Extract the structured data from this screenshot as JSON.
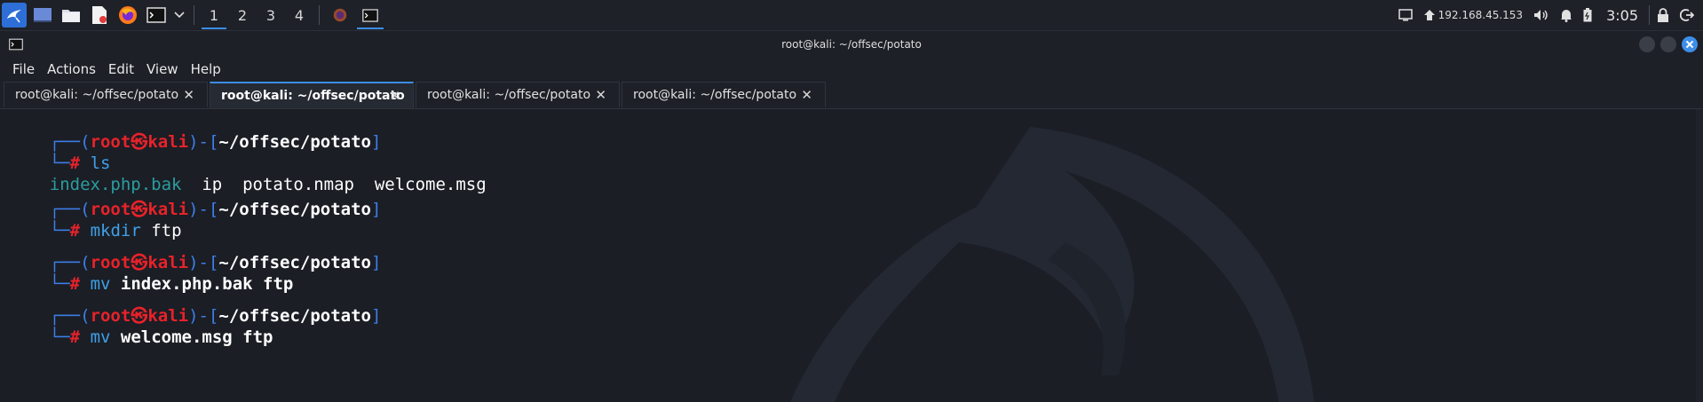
{
  "panel": {
    "workspaces": [
      "1",
      "2",
      "3",
      "4"
    ],
    "active_workspace": "1",
    "ip": "192.168.45.153",
    "clock": "3:05"
  },
  "window": {
    "title": "root@kali: ~/offsec/potato"
  },
  "menu": [
    "File",
    "Actions",
    "Edit",
    "View",
    "Help"
  ],
  "tabs": [
    {
      "label": "root@kali: ~/offsec/potato",
      "active": false
    },
    {
      "label": "root@kali: ~/offsec/potato",
      "active": true
    },
    {
      "label": "root@kali: ~/offsec/potato",
      "active": false
    },
    {
      "label": "root@kali: ~/offsec/potato",
      "active": false
    }
  ],
  "terminal": {
    "prompt": {
      "open": "┌──(",
      "user": "root",
      "at": "㉿",
      "host": "kali",
      "mid": ")-[",
      "path": "~/offsec/potato",
      "close": "]",
      "second": "└─",
      "hash": "#"
    },
    "blocks": [
      {
        "cmd": "ls",
        "args": "",
        "output": {
          "file1": "index.php.bak",
          "rest": "  ip  potato.nmap  welcome.msg"
        }
      },
      {
        "cmd": "mkdir",
        "args": " ftp"
      },
      {
        "cmd": "mv",
        "args": " index.php.bak ftp"
      },
      {
        "cmd": "mv",
        "args": " welcome.msg ftp"
      }
    ]
  },
  "colors": {
    "accent": "#3d8ee8",
    "prompt_red": "#e8222a",
    "prompt_blue": "#3d7ee8",
    "dir_cyan": "#2a9da0"
  }
}
